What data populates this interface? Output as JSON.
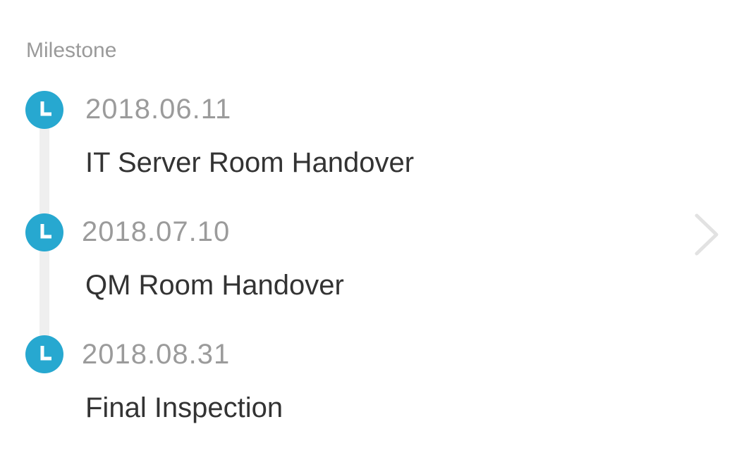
{
  "section": {
    "title": "Milestone"
  },
  "milestones": [
    {
      "date": "2018.06.11",
      "name": "IT Server Room Handover"
    },
    {
      "date": "2018.07.10",
      "name": "QM Room Handover"
    },
    {
      "date": "2018.08.31",
      "name": "Final Inspection"
    }
  ],
  "icons": {
    "status": "clock-icon",
    "navigate": "chevron-right-icon"
  },
  "colors": {
    "accent": "#27a8d0",
    "title_text": "#333333",
    "date_text": "#9b9b9b",
    "timeline": "#efefef"
  }
}
